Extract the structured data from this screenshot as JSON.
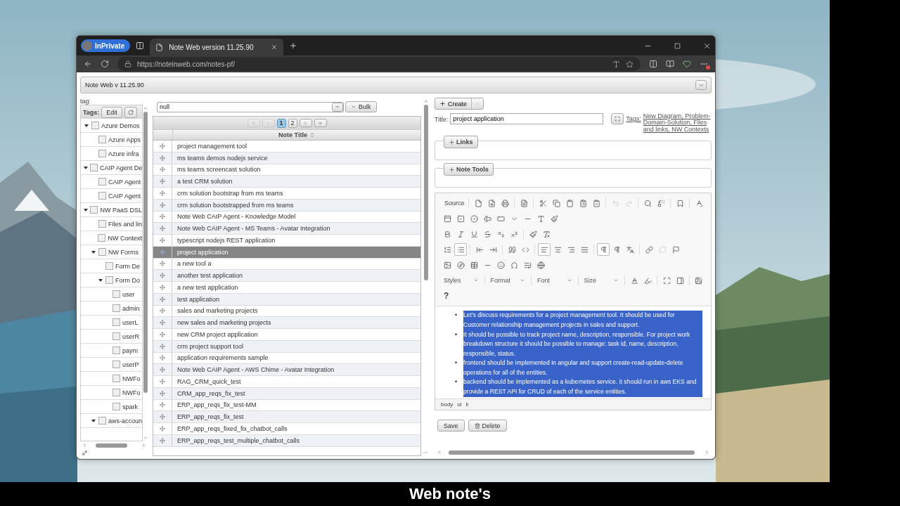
{
  "browser": {
    "private_badge": "InPrivate",
    "tabs": [
      {
        "title": "Note Web version 11.25.90",
        "selected": true
      }
    ],
    "url": "https://noteinweb.com/notes-pf/"
  },
  "app": {
    "title": "Note Web v 11.25.90"
  },
  "tag_panel": {
    "label": "tag:",
    "tags_label": "Tags:",
    "edit_button": "Edit",
    "tree": [
      {
        "label": "Azure Demos",
        "checked": false,
        "expanded": true,
        "children": [
          {
            "label": "Azure Apps",
            "checked": false
          },
          {
            "label": "Azure infra",
            "checked": false
          }
        ]
      },
      {
        "label": "CAIP Agent De",
        "checked": false,
        "expanded": true,
        "children": [
          {
            "label": "CAIP Agent",
            "checked": false
          },
          {
            "label": "CAIP Agent",
            "checked": false
          }
        ]
      },
      {
        "label": "NW PaaS DSL",
        "checked": false,
        "expanded": true,
        "children": [
          {
            "label": "Files and lin",
            "checked": false
          },
          {
            "label": "NW Context",
            "checked": false
          },
          {
            "label": "NW Forms",
            "checked": false,
            "expanded": true,
            "children": [
              {
                "label": "Form De",
                "checked": false
              },
              {
                "label": "Form Do",
                "checked": false,
                "expanded": true,
                "children": [
                  {
                    "label": "user",
                    "checked": false
                  },
                  {
                    "label": "admin",
                    "checked": false
                  },
                  {
                    "label": "userL",
                    "checked": false
                  },
                  {
                    "label": "userR",
                    "checked": false
                  },
                  {
                    "label": "paym",
                    "checked": false
                  },
                  {
                    "label": "userP",
                    "checked": false
                  },
                  {
                    "label": "NWFo",
                    "checked": false
                  },
                  {
                    "label": "NWFo",
                    "checked": false
                  },
                  {
                    "label": "spark",
                    "checked": false
                  }
                ]
              }
            ]
          },
          {
            "label": "aws-accoun",
            "checked": false,
            "expanded": true
          }
        ]
      }
    ]
  },
  "notes": {
    "filter": "null",
    "bulk_button": "Bulk",
    "first_disabled": true,
    "prev_disabled": true,
    "next_disabled": false,
    "last_disabled": false,
    "pages": [
      {
        "label": "1",
        "selected": true
      },
      {
        "label": "2",
        "selected": false
      }
    ],
    "column": "Note Title",
    "rows": [
      {
        "title": "project management tool",
        "selected": false
      },
      {
        "title": "ms teams demos nodejs service",
        "selected": false
      },
      {
        "title": "ms teams screencast solution",
        "selected": false
      },
      {
        "title": "a test CRM solution",
        "selected": false
      },
      {
        "title": "crm solution bootstrap from ms teams",
        "selected": false
      },
      {
        "title": "crm solution bootstrapped from ms teams",
        "selected": false
      },
      {
        "title": "Note Web CAIP Agent - Knowledge Model",
        "selected": false
      },
      {
        "title": "Note Web CAIP Agent - MS Teams - Avatar Integration",
        "selected": false
      },
      {
        "title": "typescript nodejs REST application",
        "selected": false
      },
      {
        "title": "project application",
        "selected": true
      },
      {
        "title": "a new tool a",
        "selected": false
      },
      {
        "title": "another test application",
        "selected": false
      },
      {
        "title": "a new test application",
        "selected": false
      },
      {
        "title": "test application",
        "selected": false
      },
      {
        "title": "sales and marketing projects",
        "selected": false
      },
      {
        "title": "new sales and marketing projects",
        "selected": false
      },
      {
        "title": "new CRM project application",
        "selected": false
      },
      {
        "title": "crm project support tool",
        "selected": false
      },
      {
        "title": "application requirements sample",
        "selected": false
      },
      {
        "title": "Note Web CAIP Agent - AWS Chime - Avatar Integration",
        "selected": false
      },
      {
        "title": "RAG_CRM_quick_test",
        "selected": false
      },
      {
        "title": "CRM_app_reqs_fix_test",
        "selected": false
      },
      {
        "title": "ERP_app_reqs_fix_test-MM",
        "selected": false
      },
      {
        "title": "ERP_app_reqs_fix_test",
        "selected": false
      },
      {
        "title": "ERP_app_reqs_fixed_fix_chatbot_calls",
        "selected": false
      },
      {
        "title": "ERP_app_reqs_test_multiple_chatbot_calls",
        "selected": false
      }
    ]
  },
  "editor": {
    "create_button": "Create",
    "title_label": "Title:",
    "title_value": "project application",
    "tags_label": "Tags:",
    "tags": "New Diagram, Problem-Domain-Solution, Files and links, NW Contexts",
    "sections": [
      {
        "label": "Links",
        "expanded": false
      },
      {
        "label": "Note Tools",
        "expanded": false
      }
    ],
    "toolbar": {
      "source": "Source",
      "undo_disabled": true,
      "redo_disabled": true,
      "bulleted_list_active": true,
      "align_left_active": true,
      "ltr_active": true,
      "unlink_disabled": true,
      "combos": [
        "Styles",
        "Format",
        "Font",
        "Size"
      ],
      "help": "?"
    },
    "content": [
      {
        "bullet": "•",
        "text": "Let's discuss requirements for a project management tool. It should be used for Customer relationship management projects in sales and support.",
        "selected": true
      },
      {
        "bullet": "•",
        "text": "It should be possible to track project name, description, responsible. For project work breakdown structure it should be possible to manage: task id, name, description, responsible, status.",
        "selected": true
      },
      {
        "bullet": "•",
        "text": "frontend should be implemented in angular and support create-read-update-delete operations for all of the entities.",
        "selected": true
      },
      {
        "bullet": "•",
        "text": "backend should be implemented as a kubernetes service. it should run in aws EKS and provide a REST API for CRUD of each of the service entities.",
        "selected": true
      }
    ],
    "path": [
      "body",
      "ul",
      "li"
    ],
    "buttons": [
      {
        "label": "Save",
        "kind": "save"
      },
      {
        "label": "Delete",
        "kind": "delete"
      }
    ]
  },
  "caption": "Web note's"
}
